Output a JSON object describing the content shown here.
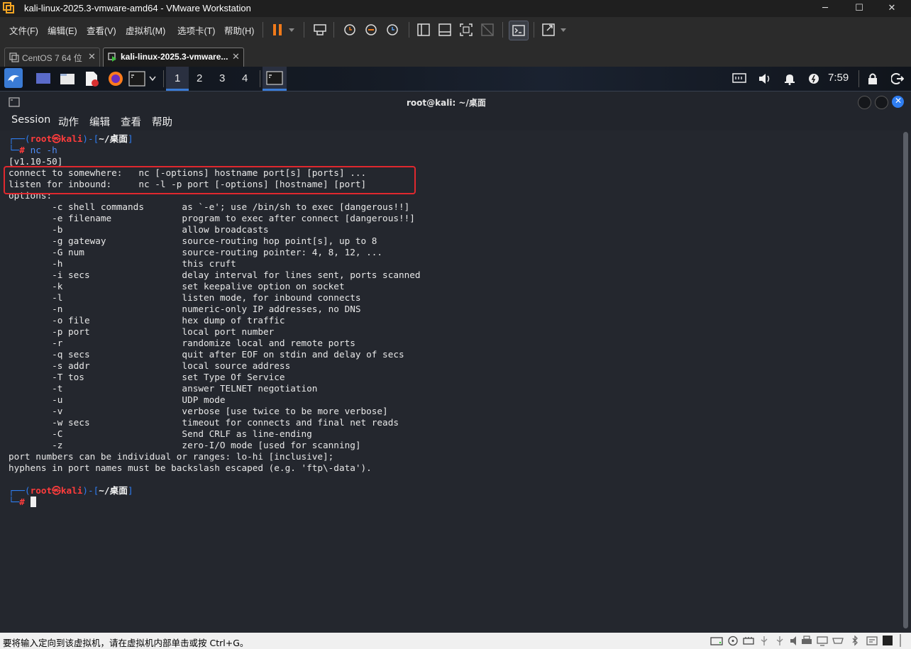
{
  "window": {
    "title": "kali-linux-2025.3-vmware-amd64 - VMware Workstation",
    "controls": {
      "minimize": "─",
      "maximize": "☐",
      "close": "✕"
    }
  },
  "menubar": {
    "items": [
      "文件(F)",
      "编辑(E)",
      "查看(V)",
      "虚拟机(M)",
      "选项卡(T)",
      "帮助(H)"
    ]
  },
  "tabs": [
    {
      "label": "CentOS 7 64 位",
      "active": false
    },
    {
      "label": "kali-linux-2025.3-vmware...",
      "active": true
    }
  ],
  "kali_panel": {
    "workspaces": [
      "1",
      "2",
      "3",
      "4"
    ],
    "active_workspace": "1",
    "clock": "7:59"
  },
  "terminal": {
    "title": "root@kali: ~/桌面",
    "menu": [
      "Session",
      "动作",
      "编辑",
      "查看",
      "帮助"
    ],
    "prompt": {
      "user": "root",
      "at": "㉿",
      "host": "kali",
      "path": "~/桌面",
      "symbol": "#"
    },
    "command": "nc -h",
    "output": [
      "[v1.10-50]",
      "connect to somewhere:   nc [-options] hostname port[s] [ports] ...",
      "listen for inbound:     nc -l -p port [-options] [hostname] [port]",
      "options:",
      "        -c shell commands       as `-e'; use /bin/sh to exec [dangerous!!]",
      "        -e filename             program to exec after connect [dangerous!!]",
      "        -b                      allow broadcasts",
      "        -g gateway              source-routing hop point[s], up to 8",
      "        -G num                  source-routing pointer: 4, 8, 12, ...",
      "        -h                      this cruft",
      "        -i secs                 delay interval for lines sent, ports scanned",
      "        -k                      set keepalive option on socket",
      "        -l                      listen mode, for inbound connects",
      "        -n                      numeric-only IP addresses, no DNS",
      "        -o file                 hex dump of traffic",
      "        -p port                 local port number",
      "        -r                      randomize local and remote ports",
      "        -q secs                 quit after EOF on stdin and delay of secs",
      "        -s addr                 local source address",
      "        -T tos                  set Type Of Service",
      "        -t                      answer TELNET negotiation",
      "        -u                      UDP mode",
      "        -v                      verbose [use twice to be more verbose]",
      "        -w secs                 timeout for connects and final net reads",
      "        -C                      Send CRLF as line-ending",
      "        -z                      zero-I/O mode [used for scanning]",
      "port numbers can be individual or ranges: lo-hi [inclusive];",
      "hyphens in port names must be backslash escaped (e.g. 'ftp\\-data')."
    ]
  },
  "statusbar": {
    "message": "要将输入定向到该虚拟机，请在虚拟机内部单击或按 Ctrl+G。"
  },
  "colors": {
    "highlight_box": "#e0282e",
    "prompt_blue": "#2f7ef2",
    "prompt_red": "#ff3c3c",
    "pause_orange": "#f07a1a",
    "terminal_bg": "#24272e"
  }
}
